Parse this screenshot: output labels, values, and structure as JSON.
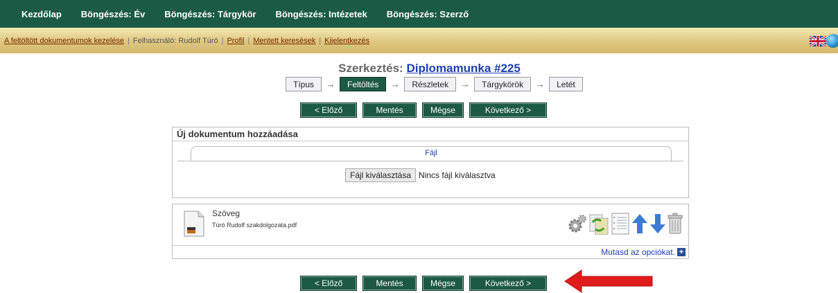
{
  "topnav": {
    "items": [
      "Kezdőlap",
      "Böngészés: Év",
      "Böngészés: Tárgykör",
      "Böngészés: Intézetek",
      "Böngészés: Szerző"
    ]
  },
  "subbar": {
    "manage_link": "A feltöltött dokumentumok kezelése",
    "user_label": "Felhasználó: Rudolf Túró",
    "profile_link": "Profil",
    "saved_searches_link": "Mentett keresések",
    "logout_link": "Kijelentkezés"
  },
  "title": {
    "prefix": "Szerkeztés:",
    "link": "Diplomamunka #225"
  },
  "steps": [
    "Típus",
    "Feltöltés",
    "Részletek",
    "Tárgykörök",
    "Letét"
  ],
  "active_step": "Feltöltés",
  "buttons": {
    "prev": "< Előző",
    "save": "Mentés",
    "cancel": "Mégse",
    "next": "Következő >"
  },
  "add_panel": {
    "heading": "Új dokumentum hozzáadása",
    "tab_label": "Fájl",
    "file_button": "Fájl kiválasztása",
    "file_status": "Nincs fájl kiválasztva"
  },
  "document": {
    "title": "Szöveg",
    "filename": "Túró Rudolf szakdolgozata.pdf",
    "options_link": "Mutasd az opciókat."
  },
  "colors": {
    "brand_green": "#1b5a45",
    "link_blue": "#1c3fae",
    "annotation_red": "#e01b1b"
  }
}
